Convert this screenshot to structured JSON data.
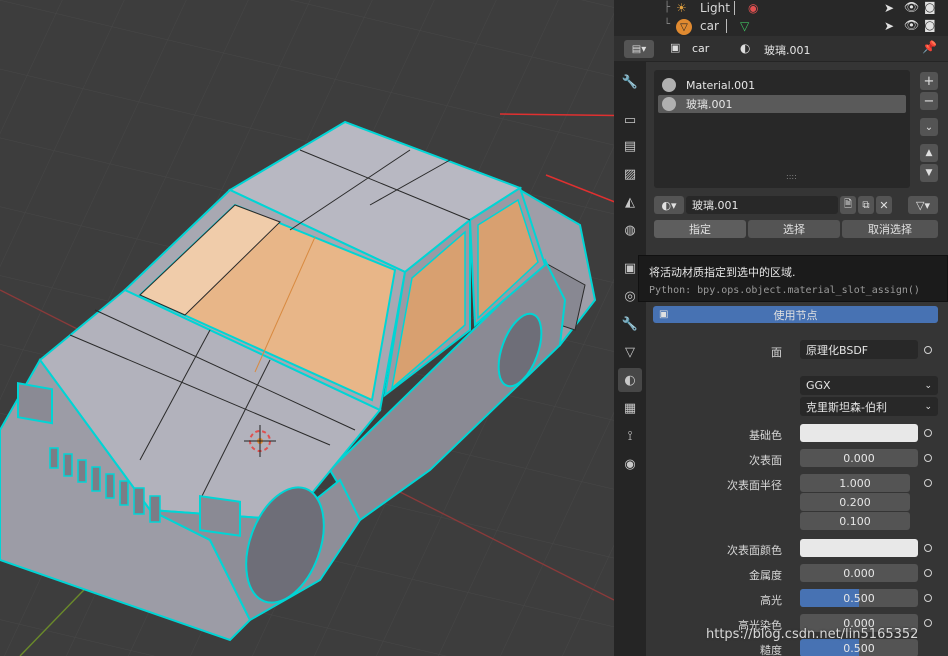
{
  "outliner": {
    "rows": [
      {
        "label": "Light",
        "icon": "light-icon"
      },
      {
        "label": "car",
        "icon": "mesh-icon"
      }
    ]
  },
  "header": {
    "object_name": "car",
    "material_name": "玻璃.001"
  },
  "material_slots": [
    {
      "label": "Material.001",
      "selected": false
    },
    {
      "label": "玻璃.001",
      "selected": true
    }
  ],
  "slot_list_grip": "::::",
  "material_selector": {
    "name": "玻璃.001"
  },
  "edit_buttons": {
    "assign": "指定",
    "select": "选择",
    "deselect": "取消选择"
  },
  "tooltip": {
    "description": "将活动材质指定到选中的区域.",
    "python": "Python: bpy.ops.object.material_slot_assign()"
  },
  "use_nodes_label": "使用节点",
  "surface": {
    "label": "面",
    "shader": "原理化BSDF",
    "distribution": "GGX",
    "subsurface_method": "克里斯坦森-伯利"
  },
  "properties": {
    "base_color_label": "基础色",
    "subsurface_label": "次表面",
    "subsurface_value": "0.000",
    "subsurface_radius_label": "次表面半径",
    "subsurface_radius": [
      "1.000",
      "0.200",
      "0.100"
    ],
    "subsurface_color_label": "次表面颜色",
    "metallic_label": "金属度",
    "metallic_value": "0.000",
    "specular_label": "高光",
    "specular_value": "0.500",
    "specular_fraction": 0.5,
    "specular_tint_label": "高光染色",
    "specular_tint_value": "0.000",
    "roughness_label": "糙度",
    "roughness_value": "0.500",
    "roughness_fraction": 0.5
  },
  "watermark": "https://blog.csdn.net/lin5165352",
  "colors": {
    "accent_blue": "#4772b3",
    "selection_cyan": "#00d5d5",
    "face_selected": "#e8b688",
    "arrow_red": "#e03030",
    "base_color_swatch": "#e8e8e8"
  }
}
